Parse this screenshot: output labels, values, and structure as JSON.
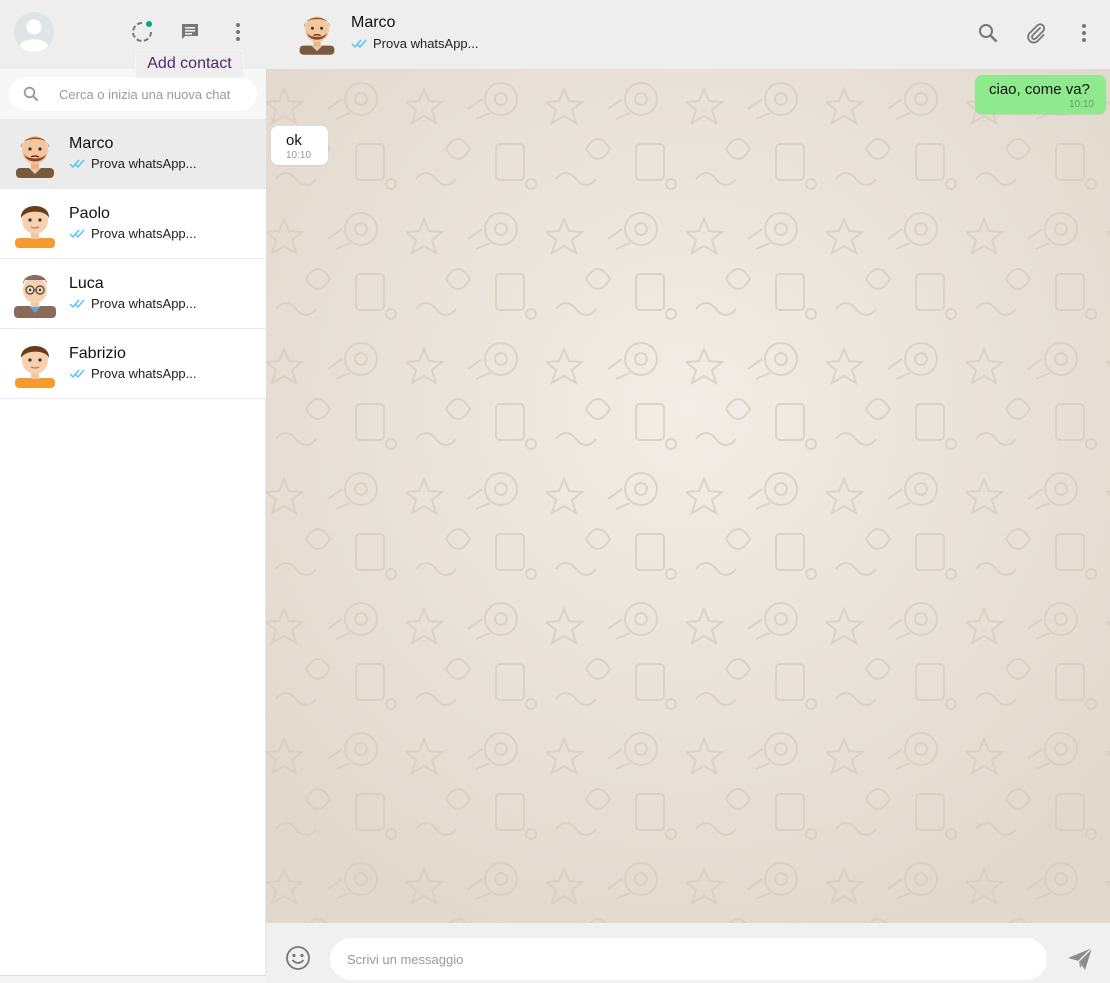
{
  "sidebar": {
    "profile_avatar_icon": "default-profile-icon",
    "actions": [
      {
        "icon": "status-icon",
        "accent": "#00a884"
      },
      {
        "icon": "new-chat-icon"
      },
      {
        "icon": "more-vertical-icon"
      }
    ],
    "tooltip": "Add contact",
    "search": {
      "placeholder": "Cerca o inizia una nuova chat",
      "value": ""
    },
    "chats": [
      {
        "name": "Marco",
        "preview": "Prova whatsApp...",
        "active": true
      },
      {
        "name": "Paolo",
        "preview": "Prova whatsApp...",
        "active": false
      },
      {
        "name": "Luca",
        "preview": "Prova whatsApp...",
        "active": false
      },
      {
        "name": "Fabrizio",
        "preview": "Prova whatsApp...",
        "active": false
      }
    ]
  },
  "conversation": {
    "contact": {
      "name": "Marco",
      "status": "Prova whatsApp..."
    },
    "header_actions": [
      "search-icon",
      "attach-icon",
      "more-vertical-icon"
    ],
    "messages": [
      {
        "direction": "out",
        "text": "ciao, come va?",
        "time": "10:10"
      },
      {
        "direction": "in",
        "text": "ok",
        "time": "10:10"
      }
    ],
    "composer": {
      "placeholder": "Scrivi un messaggio",
      "value": ""
    }
  },
  "colors": {
    "outgoing_bubble": "#8fea8e",
    "incoming_bubble": "#ffffff",
    "read_ticks": "#4fc3f7",
    "wallpaper": "#e6ddd3",
    "header_bg": "#eeeeee",
    "tooltip_text": "#4a2a6a"
  }
}
